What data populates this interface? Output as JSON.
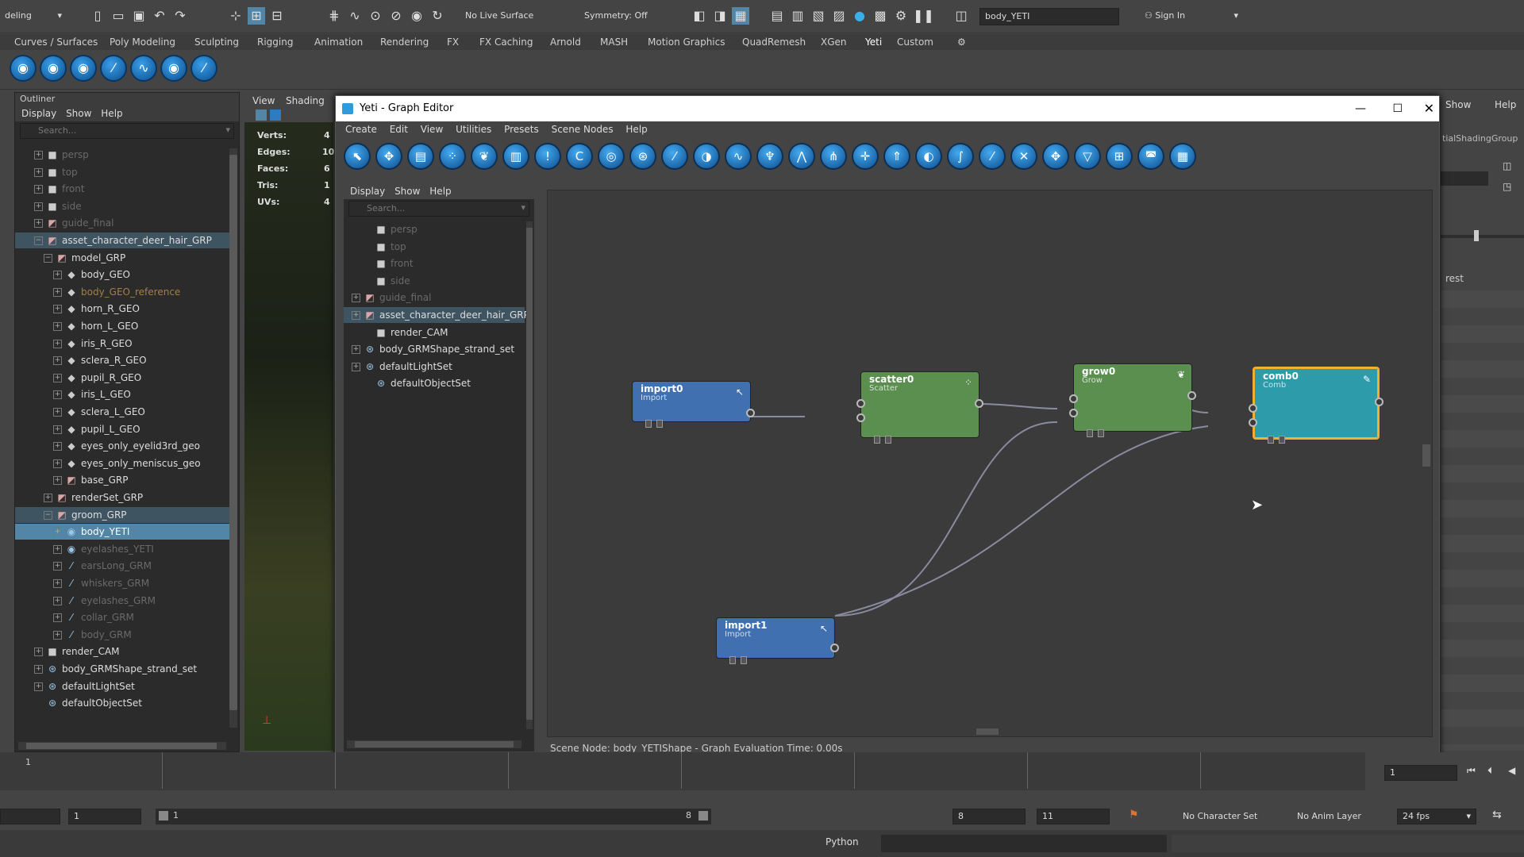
{
  "statusline": {
    "mode_menu": "deling",
    "live_surface": "No Live Surface",
    "symmetry": "Symmetry: Off",
    "object_field": "body_YETI",
    "sign_in": "Sign In"
  },
  "shelf_tabs": [
    "Curves / Surfaces",
    "Poly Modeling",
    "Sculpting",
    "Rigging",
    "Animation",
    "Rendering",
    "FX",
    "FX Caching",
    "Arnold",
    "MASH",
    "Motion Graphics",
    "QuadRemesh",
    "XGen",
    "Yeti",
    "Custom"
  ],
  "outliner": {
    "title": "Outliner",
    "menu": [
      "Display",
      "Show",
      "Help"
    ],
    "search_placeholder": "Search...",
    "items": [
      {
        "label": "persp",
        "style": "dim",
        "icon": "camera-icon"
      },
      {
        "label": "top",
        "style": "dim",
        "icon": "camera-icon"
      },
      {
        "label": "front",
        "style": "dim",
        "icon": "camera-icon"
      },
      {
        "label": "side",
        "style": "dim",
        "icon": "camera-icon"
      },
      {
        "label": "guide_final",
        "style": "dim",
        "icon": "group-icon"
      },
      {
        "label": "asset_character_deer_hair_GRP",
        "style": "hl",
        "icon": "group-icon"
      },
      {
        "label": "model_GRP",
        "style": "",
        "icon": "group-icon"
      },
      {
        "label": "body_GEO",
        "style": "",
        "icon": "mesh-icon"
      },
      {
        "label": "body_GEO_reference",
        "style": "orange",
        "icon": "mesh-icon"
      },
      {
        "label": "horn_R_GEO",
        "style": "",
        "icon": "mesh-icon"
      },
      {
        "label": "horn_L_GEO",
        "style": "",
        "icon": "mesh-icon"
      },
      {
        "label": "iris_R_GEO",
        "style": "",
        "icon": "mesh-icon"
      },
      {
        "label": "sclera_R_GEO",
        "style": "",
        "icon": "mesh-icon"
      },
      {
        "label": "pupil_R_GEO",
        "style": "",
        "icon": "mesh-icon"
      },
      {
        "label": "iris_L_GEO",
        "style": "",
        "icon": "mesh-icon"
      },
      {
        "label": "sclera_L_GEO",
        "style": "",
        "icon": "mesh-icon"
      },
      {
        "label": "pupil_L_GEO",
        "style": "",
        "icon": "mesh-icon"
      },
      {
        "label": "eyes_only_eyelid3rd_geo",
        "style": "",
        "icon": "mesh-icon"
      },
      {
        "label": "eyes_only_meniscus_geo",
        "style": "",
        "icon": "mesh-icon"
      },
      {
        "label": "base_GRP",
        "style": "",
        "icon": "group-icon"
      },
      {
        "label": "renderSet_GRP",
        "style": "",
        "icon": "group-icon"
      },
      {
        "label": "groom_GRP",
        "style": "hl",
        "icon": "group-icon"
      },
      {
        "label": "body_YETI",
        "style": "sel",
        "icon": "yeti-icon"
      },
      {
        "label": "eyelashes_YETI",
        "style": "dim",
        "icon": "yeti-icon"
      },
      {
        "label": "earsLong_GRM",
        "style": "dim",
        "icon": "groom-icon"
      },
      {
        "label": "whiskers_GRM",
        "style": "dim",
        "icon": "groom-icon"
      },
      {
        "label": "eyelashes_GRM",
        "style": "dim",
        "icon": "groom-icon"
      },
      {
        "label": "collar_GRM",
        "style": "dim",
        "icon": "groom-icon"
      },
      {
        "label": "body_GRM",
        "style": "dim",
        "icon": "groom-icon"
      },
      {
        "label": "render_CAM",
        "style": "",
        "icon": "camera-icon"
      },
      {
        "label": "body_GRMShape_strand_set",
        "style": "",
        "icon": "set-icon"
      },
      {
        "label": "defaultLightSet",
        "style": "",
        "icon": "set-icon"
      },
      {
        "label": "defaultObjectSet",
        "style": "",
        "icon": "set-icon"
      }
    ]
  },
  "viewport": {
    "menu": [
      "View",
      "Shading"
    ],
    "hud": [
      {
        "label": "Verts:",
        "value": "4"
      },
      {
        "label": "Edges:",
        "value": "10"
      },
      {
        "label": "Faces:",
        "value": "6"
      },
      {
        "label": "Tris:",
        "value": "1"
      },
      {
        "label": "UVs:",
        "value": "4"
      }
    ]
  },
  "right_panel": {
    "show": "Show",
    "help": "Help",
    "attr": "tialShadingGroup",
    "rest": "rest"
  },
  "yeti": {
    "title": "Yeti - Graph Editor",
    "menu": [
      "Create",
      "Edit",
      "View",
      "Utilities",
      "Presets",
      "Scene Nodes",
      "Help"
    ],
    "side_menu": [
      "Display",
      "Show",
      "Help"
    ],
    "search_placeholder": "Search...",
    "side_items": [
      {
        "label": "persp",
        "style": "dim",
        "icon": "camera-icon"
      },
      {
        "label": "top",
        "style": "dim",
        "icon": "camera-icon"
      },
      {
        "label": "front",
        "style": "dim",
        "icon": "camera-icon"
      },
      {
        "label": "side",
        "style": "dim",
        "icon": "camera-icon"
      },
      {
        "label": "guide_final",
        "style": "dim",
        "icon": "group-icon"
      },
      {
        "label": "asset_character_deer_hair_GRP",
        "style": "hl",
        "icon": "group-icon"
      },
      {
        "label": "render_CAM",
        "style": "",
        "icon": "camera-icon"
      },
      {
        "label": "body_GRMShape_strand_set",
        "style": "",
        "icon": "set-icon"
      },
      {
        "label": "defaultLightSet",
        "style": "",
        "icon": "set-icon"
      },
      {
        "label": "defaultObjectSet",
        "style": "",
        "icon": "set-icon"
      }
    ],
    "nodes": [
      {
        "id": "import0",
        "title": "import0",
        "sub": "Import",
        "color": "#4170b0"
      },
      {
        "id": "scatter0",
        "title": "scatter0",
        "sub": "Scatter",
        "color": "#5b8f4f"
      },
      {
        "id": "grow0",
        "title": "grow0",
        "sub": "Grow",
        "color": "#5b8f4f"
      },
      {
        "id": "comb0",
        "title": "comb0",
        "sub": "Comb",
        "color": "#2e9bab"
      },
      {
        "id": "import1",
        "title": "import1",
        "sub": "Import",
        "color": "#4170b0"
      }
    ],
    "status": "Scene Node: body_YETIShape - Graph Evaluation Time: 0.00s"
  },
  "timeline": {
    "current_frame": "1",
    "frame_left": "1"
  },
  "range": {
    "start": "1",
    "inner_start": "1",
    "inner_end": "8",
    "end": "8",
    "max": "11",
    "character_set": "No Character Set",
    "anim_layer": "No Anim Layer",
    "fps": "24 fps"
  },
  "cmdline": {
    "lang": "Python"
  }
}
